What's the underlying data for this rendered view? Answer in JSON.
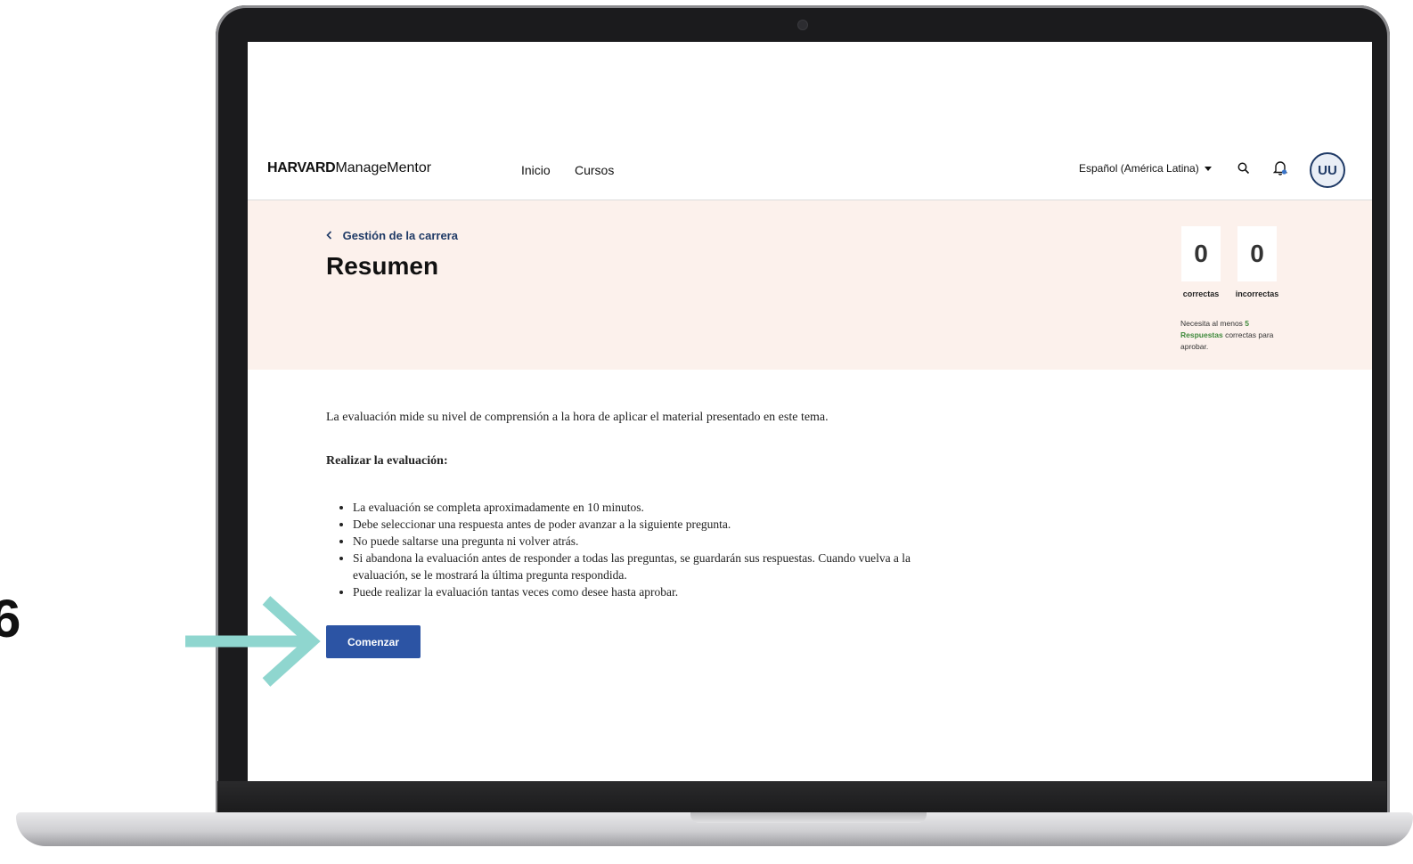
{
  "header": {
    "logo_bold": "HARVARD",
    "logo_light": "ManageMentor",
    "nav": [
      "Inicio",
      "Cursos"
    ],
    "language": "Español (América Latina)",
    "avatar_initials": "UU"
  },
  "hero": {
    "back_label": "Gestión de la carrera",
    "title": "Resumen",
    "correct_count": "0",
    "correct_label": "correctas",
    "incorrect_count": "0",
    "incorrect_label": "incorrectas",
    "hint_prefix": "Necesita al menos ",
    "hint_number": "5",
    "hint_word": "Respuestas",
    "hint_suffix": " correctas para aprobar."
  },
  "content": {
    "intro": "La evaluación mide su nivel de comprensión a la hora de aplicar el material presentado en este tema.",
    "subhead": "Realizar la evaluación:",
    "bullets": [
      "La evaluación se completa aproximadamente en 10 minutos.",
      "Debe seleccionar una respuesta antes de poder avanzar a la siguiente pregunta.",
      "No puede saltarse una pregunta ni volver atrás.",
      "Si abandona la evaluación antes de responder a todas las preguntas, se guardarán sus respuestas. Cuando vuelva a la evaluación, se le mostrará la última pregunta respondida.",
      "Puede realizar la evaluación tantas veces como desee hasta aprobar."
    ],
    "start_button": "Comenzar"
  },
  "side_glyph": "6",
  "colors": {
    "accent_blue": "#2c54a4",
    "hero_bg": "#fcf1ec",
    "arrow_teal": "#8fd6cf",
    "hint_green": "#3f8a3c"
  },
  "icons": [
    "search-icon",
    "bell-icon",
    "chevron-left-icon",
    "caret-down-icon",
    "arrow-right-icon"
  ]
}
